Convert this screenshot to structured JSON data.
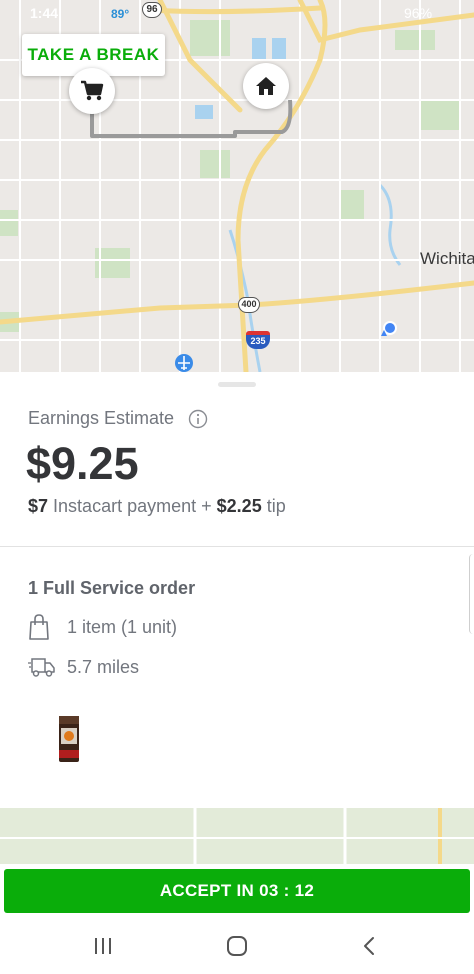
{
  "status_bar": {
    "time": "1:44",
    "temperature": "89°",
    "battery": "96%"
  },
  "map": {
    "take_break_label": "TAKE A BREAK",
    "city_label": "Wichita",
    "shields": {
      "route_96": "96",
      "route_400": "400",
      "route_235": "235"
    },
    "icons": {
      "store_pin": "cart-icon",
      "home_pin": "home-icon",
      "airport": "airplane-icon",
      "current_location": "location-dot"
    }
  },
  "earnings": {
    "label": "Earnings Estimate",
    "amount": "$9.25",
    "payment_amount": "$7",
    "payment_text": "Instacart payment +",
    "tip_amount": "$2.25",
    "tip_text": "tip"
  },
  "order": {
    "title": "1 Full Service order",
    "items": "1 item (1 unit)",
    "distance": "5.7 miles"
  },
  "accept_button": {
    "label": "ACCEPT IN 03 : 12"
  },
  "colors": {
    "brand_green": "#0aad0a",
    "text_dark": "#343538",
    "text_muted": "#72767e"
  }
}
